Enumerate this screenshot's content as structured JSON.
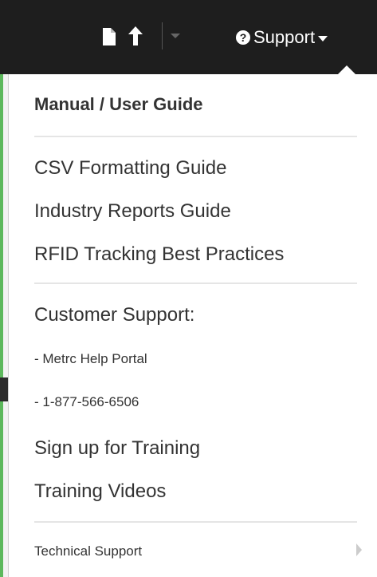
{
  "toolbar": {
    "icons": [
      "file-icon",
      "arrow-up-icon",
      "caret-down-icon"
    ],
    "support_label": "Support",
    "help_glyph": "?"
  },
  "menu": {
    "header": "Manual / User Guide",
    "items": [
      "CSV Formatting Guide",
      "Industry Reports Guide",
      "RFID Tracking Best Practices"
    ],
    "customer_support_label": "Customer Support:",
    "help_portal": "- Metrc Help Portal",
    "phone": "- 1-877-566-6506",
    "sign_up": "Sign up for Training",
    "videos": "Training Videos",
    "technical_support": "Technical Support"
  },
  "colors": {
    "topbar": "#1e1e1e",
    "accent_green": "#5cb85c",
    "menu_text": "#333333"
  }
}
